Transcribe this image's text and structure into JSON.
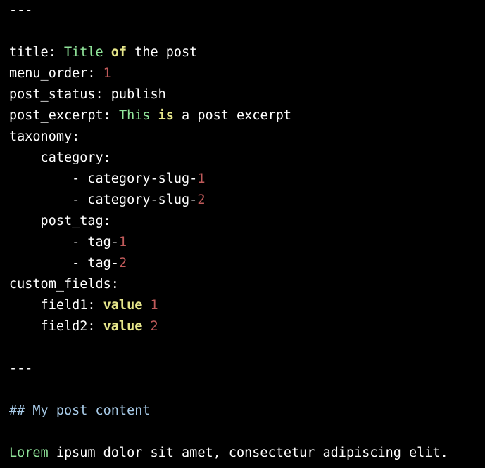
{
  "document": {
    "kind": "markdown-with-yaml-front-matter",
    "background_color": "#000000",
    "default_text_color": "#ffffff",
    "palette": {
      "plain": "#ffffff",
      "string_green": "#90e59a",
      "keyword_yellow": "#e6e68a",
      "number_red": "#c05a5a",
      "heading_blue": "#a8cbe8"
    },
    "lines": [
      {
        "id": "line-1",
        "text": "---",
        "tokens": [
          {
            "t": "---",
            "c": "plain"
          }
        ]
      },
      {
        "id": "line-2",
        "text": "",
        "tokens": [
          {
            "t": "",
            "c": "plain"
          }
        ]
      },
      {
        "id": "line-3",
        "text": "title: Title of the post",
        "tokens": [
          {
            "t": "title: ",
            "c": "plain"
          },
          {
            "t": "Title ",
            "c": "string_green"
          },
          {
            "t": "of",
            "c": "keyword_yellow"
          },
          {
            "t": " the post",
            "c": "plain"
          }
        ]
      },
      {
        "id": "line-4",
        "text": "menu_order: 1",
        "tokens": [
          {
            "t": "menu_order: ",
            "c": "plain"
          },
          {
            "t": "1",
            "c": "number_red"
          }
        ]
      },
      {
        "id": "line-5",
        "text": "post_status: publish",
        "tokens": [
          {
            "t": "post_status: publish",
            "c": "plain"
          }
        ]
      },
      {
        "id": "line-6",
        "text": "post_excerpt: This is a post excerpt",
        "tokens": [
          {
            "t": "post_excerpt: ",
            "c": "plain"
          },
          {
            "t": "This ",
            "c": "string_green"
          },
          {
            "t": "is",
            "c": "keyword_yellow"
          },
          {
            "t": " a post excerpt",
            "c": "plain"
          }
        ]
      },
      {
        "id": "line-7",
        "text": "taxonomy:",
        "tokens": [
          {
            "t": "taxonomy:",
            "c": "plain"
          }
        ]
      },
      {
        "id": "line-8",
        "text": "    category:",
        "tokens": [
          {
            "t": "    category:",
            "c": "plain"
          }
        ]
      },
      {
        "id": "line-9",
        "text": "        - category-slug-1",
        "tokens": [
          {
            "t": "        - category-slug-",
            "c": "plain"
          },
          {
            "t": "1",
            "c": "number_red"
          }
        ]
      },
      {
        "id": "line-10",
        "text": "        - category-slug-2",
        "tokens": [
          {
            "t": "        - category-slug-",
            "c": "plain"
          },
          {
            "t": "2",
            "c": "number_red"
          }
        ]
      },
      {
        "id": "line-11",
        "text": "    post_tag:",
        "tokens": [
          {
            "t": "    post_tag:",
            "c": "plain"
          }
        ]
      },
      {
        "id": "line-12",
        "text": "        - tag-1",
        "tokens": [
          {
            "t": "        - tag-",
            "c": "plain"
          },
          {
            "t": "1",
            "c": "number_red"
          }
        ]
      },
      {
        "id": "line-13",
        "text": "        - tag-2",
        "tokens": [
          {
            "t": "        - tag-",
            "c": "plain"
          },
          {
            "t": "2",
            "c": "number_red"
          }
        ]
      },
      {
        "id": "line-14",
        "text": "custom_fields:",
        "tokens": [
          {
            "t": "custom_fields:",
            "c": "plain"
          }
        ]
      },
      {
        "id": "line-15",
        "text": "    field1: value 1",
        "tokens": [
          {
            "t": "    field1: ",
            "c": "plain"
          },
          {
            "t": "value",
            "c": "keyword_yellow"
          },
          {
            "t": " ",
            "c": "plain"
          },
          {
            "t": "1",
            "c": "number_red"
          }
        ]
      },
      {
        "id": "line-16",
        "text": "    field2: value 2",
        "tokens": [
          {
            "t": "    field2: ",
            "c": "plain"
          },
          {
            "t": "value",
            "c": "keyword_yellow"
          },
          {
            "t": " ",
            "c": "plain"
          },
          {
            "t": "2",
            "c": "number_red"
          }
        ]
      },
      {
        "id": "line-17",
        "text": "",
        "tokens": [
          {
            "t": "",
            "c": "plain"
          }
        ]
      },
      {
        "id": "line-18",
        "text": "---",
        "tokens": [
          {
            "t": "---",
            "c": "plain"
          }
        ]
      },
      {
        "id": "line-19",
        "text": "",
        "tokens": [
          {
            "t": "",
            "c": "plain"
          }
        ]
      },
      {
        "id": "line-20",
        "text": "## My post content",
        "tokens": [
          {
            "t": "## My post content",
            "c": "heading_blue"
          }
        ]
      },
      {
        "id": "line-21",
        "text": "",
        "tokens": [
          {
            "t": "",
            "c": "plain"
          }
        ]
      },
      {
        "id": "line-22",
        "text": "Lorem ipsum dolor sit amet, consectetur adipiscing elit.",
        "tokens": [
          {
            "t": "Lorem",
            "c": "string_green"
          },
          {
            "t": " ipsum dolor sit amet, consectetur adipiscing elit.",
            "c": "plain"
          }
        ]
      }
    ]
  }
}
